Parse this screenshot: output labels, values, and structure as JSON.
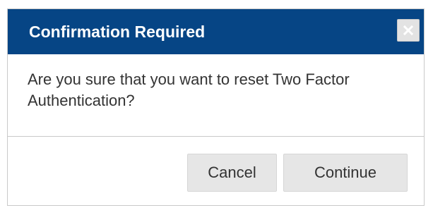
{
  "dialog": {
    "title": "Confirmation Required",
    "close_icon": "close-icon",
    "message": "Are you sure that you want to reset Two Factor Authentication?",
    "buttons": {
      "cancel_label": "Cancel",
      "continue_label": "Continue"
    }
  },
  "colors": {
    "titlebar": "#064585",
    "title_text": "#ffffff",
    "button_bg": "#e6e6e6",
    "text": "#333333"
  }
}
